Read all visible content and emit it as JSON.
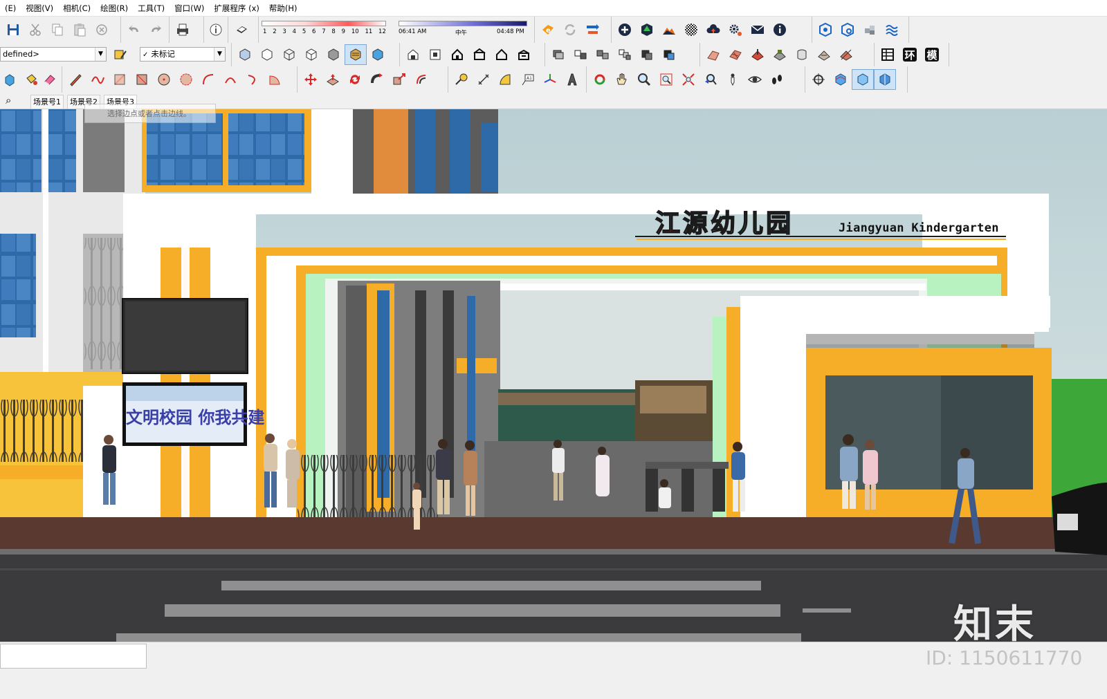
{
  "menu": {
    "items": [
      "(E)",
      "视图(V)",
      "相机(C)",
      "绘图(R)",
      "工具(T)",
      "窗口(W)",
      "扩展程序 (x)",
      "帮助(H)"
    ]
  },
  "toolbar": {
    "layer_combo_value": "defined>",
    "tag_combo_value": "未标记",
    "tag_combo_check": "✓",
    "months": [
      "1",
      "2",
      "3",
      "4",
      "5",
      "6",
      "7",
      "8",
      "9",
      "10",
      "11",
      "12"
    ],
    "time_start": "06:41 AM",
    "time_mid": "中午",
    "time_end": "04:48 PM",
    "text_icons": [
      "环",
      "模"
    ],
    "info_glyph": "i"
  },
  "scenes": {
    "search_glyph": "⌕",
    "tabs": [
      "场景号1",
      "场景号2",
      "场景号3"
    ],
    "tooltip": "选择边点或者点击边线。"
  },
  "viewport": {
    "sign_chars": [
      "江",
      "源",
      "幼",
      "儿",
      "园"
    ],
    "sign_colors": [
      "#e8232a",
      "#f59a1b",
      "#f4c21c",
      "#2f9d3a",
      "#1c7fd1"
    ],
    "sign_english": "Jiangyuan Kindergarten",
    "board_banner": "文明校园 你我共建",
    "watermark_brand": "知末"
  },
  "colors": {
    "accent_orange": "#f6ad28",
    "mint": "#b8f2c0",
    "facade_white": "#ffffff",
    "glass_blue": "#3a73b5",
    "road": "#3b3b3d",
    "sidewalk": "#5a3a30"
  },
  "status": {
    "id_label": "ID: 1150611770"
  }
}
